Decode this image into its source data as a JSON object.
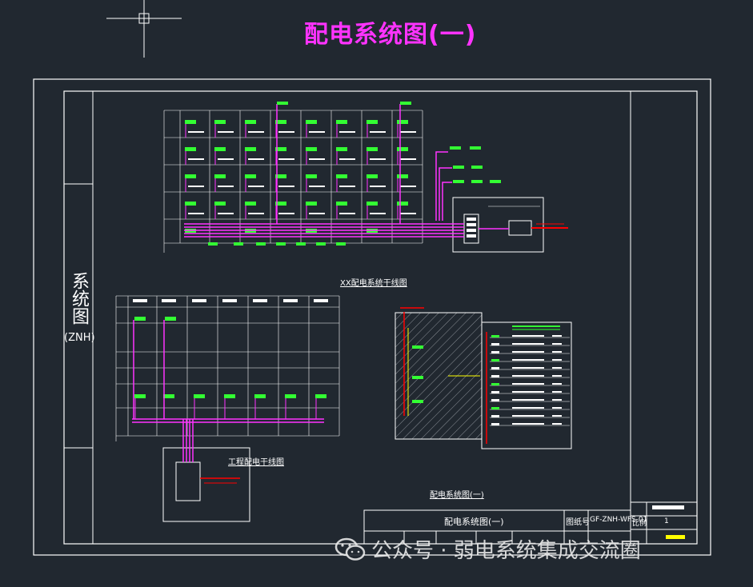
{
  "header": {
    "title": "配电系统图(一)"
  },
  "sidebar": {
    "title": "系统图",
    "code": "(ZNH)"
  },
  "diagrams": {
    "upper_caption": "XX配电系统干线图",
    "lower_caption": "工程配电干线图",
    "right_caption": "配电系统图(一)"
  },
  "title_block": {
    "drawing_name": "配电系统图(一)",
    "number_label": "图纸号",
    "number_value": "GF-ZNH-WFS-01",
    "scale_label": "比例",
    "scale_value": "1"
  },
  "watermark": {
    "text": "公众号 · 弱电系统集成交流圈"
  },
  "colors": {
    "background": "#212830",
    "frame": "#ffffff",
    "title": "#ff33ff",
    "trunk": "#ff33ff",
    "label_green": "#33ff33",
    "highlight": "#ff0000",
    "accent_yellow": "#ffff00"
  }
}
